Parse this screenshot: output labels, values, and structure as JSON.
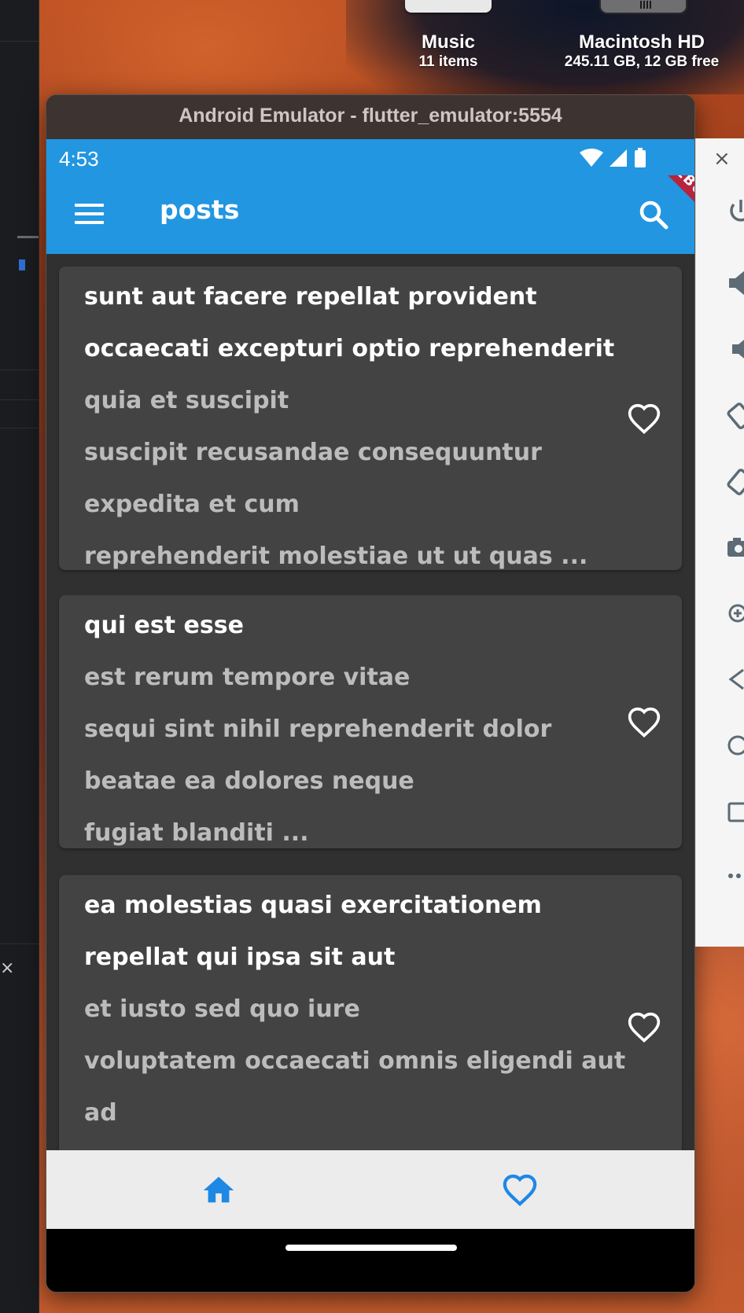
{
  "desktop": {
    "music": {
      "name": "Music",
      "detail": "11 items"
    },
    "disk": {
      "name": "Macintosh HD",
      "detail": "245.11 GB, 12 GB free"
    }
  },
  "emulator": {
    "window_title": "Android Emulator - flutter_emulator:5554"
  },
  "status_bar": {
    "time": "4:53"
  },
  "app_bar": {
    "title": "posts",
    "debug_banner": "DEBUG SELECTOR"
  },
  "posts": [
    {
      "title_lines": [
        "sunt aut facere repellat provident",
        "occaecati excepturi optio reprehenderit"
      ],
      "body_lines": [
        "quia et suscipit",
        "suscipit recusandae consequuntur",
        "expedita et cum",
        "reprehenderit molestiae ut ut quas ..."
      ]
    },
    {
      "title_lines": [
        "qui est esse"
      ],
      "body_lines": [
        "est rerum tempore vitae",
        "sequi sint nihil reprehenderit dolor",
        "beatae ea dolores neque",
        "fugiat blanditi ..."
      ]
    },
    {
      "title_lines": [
        "ea molestias quasi exercitationem",
        "repellat qui ipsa sit aut"
      ],
      "body_lines": [
        "et iusto sed quo iure",
        "voluptatem occaecati omnis eligendi aut",
        "ad"
      ]
    }
  ],
  "bottom_nav": {
    "items": [
      {
        "icon": "home-icon",
        "active": true
      },
      {
        "icon": "heart-outline-icon",
        "active": false
      }
    ],
    "active_color": "#1e88e5"
  },
  "colors": {
    "app_bar": "#2396e1",
    "card_bg": "#434343",
    "page_bg": "#303030",
    "title_text": "#ffffff",
    "body_text": "#bcbcbc"
  }
}
